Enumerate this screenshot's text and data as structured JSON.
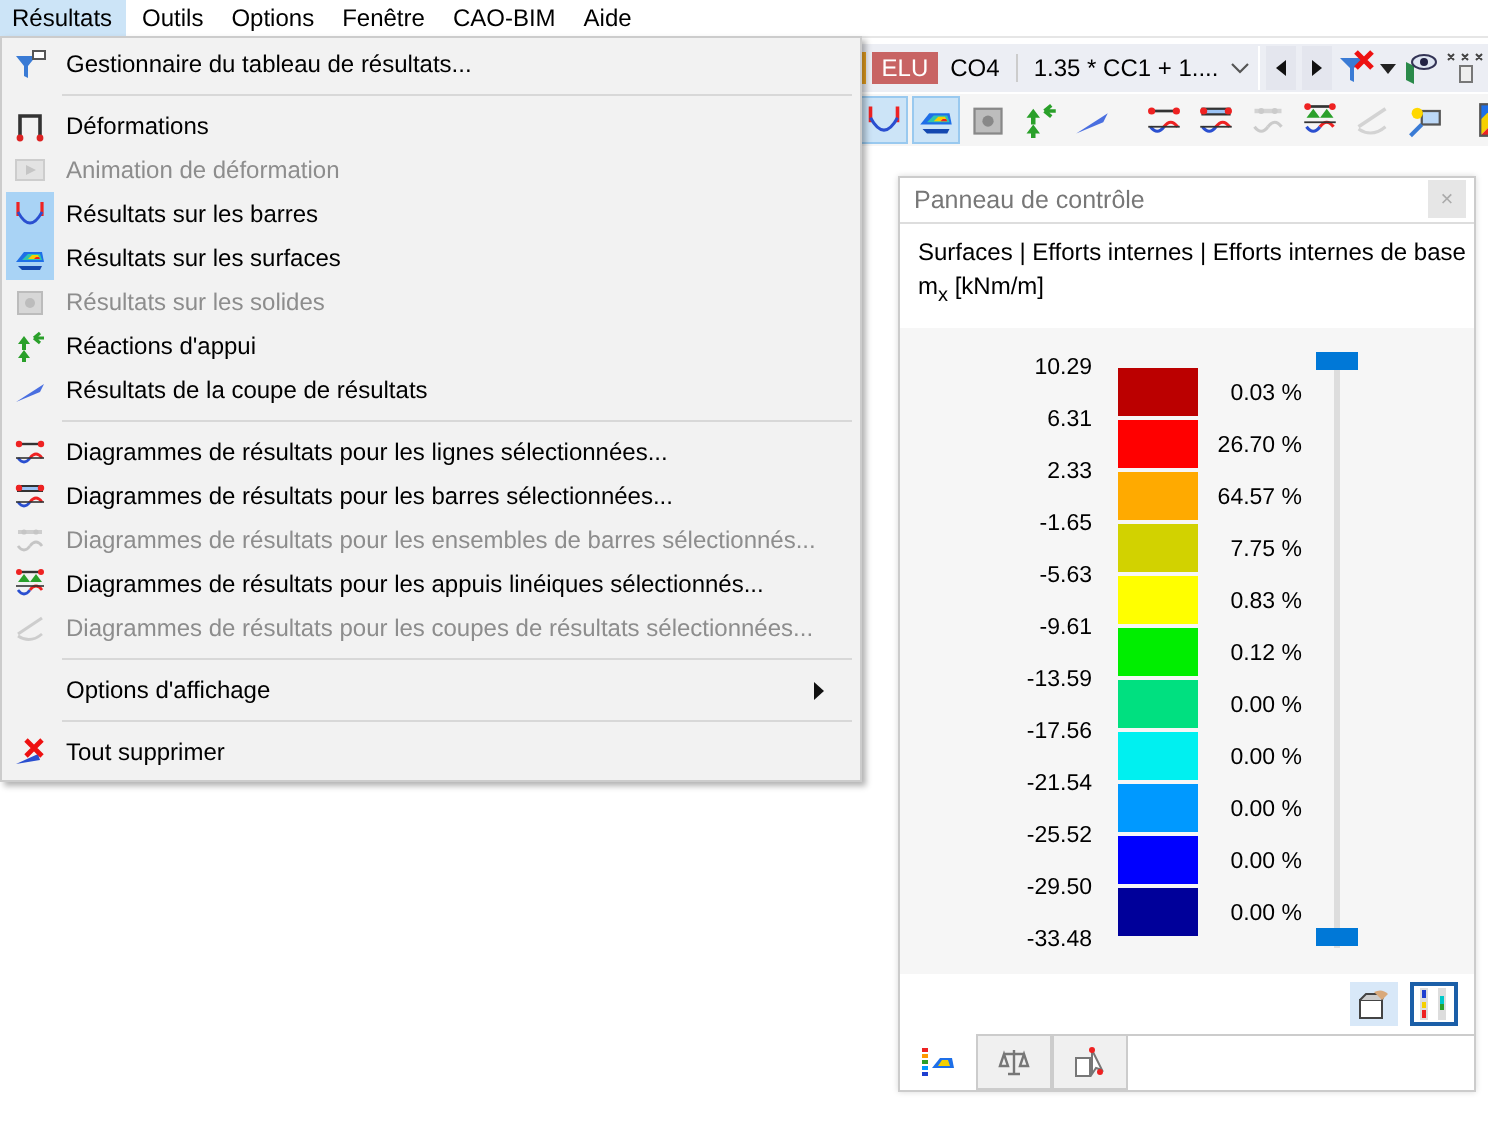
{
  "menubar": [
    {
      "label": "Résultats",
      "selected": true
    },
    {
      "label": "Outils",
      "selected": false
    },
    {
      "label": "Options",
      "selected": false
    },
    {
      "label": "Fenêtre",
      "selected": false
    },
    {
      "label": "CAO-BIM",
      "selected": false
    },
    {
      "label": "Aide",
      "selected": false
    }
  ],
  "menu": {
    "sections": [
      [
        {
          "label": "Gestionnaire du tableau de résultats...",
          "disabled": false,
          "checked": false,
          "submenu": false
        }
      ],
      [
        {
          "label": "Déformations",
          "disabled": false,
          "checked": false,
          "submenu": false
        },
        {
          "label": "Animation de déformation",
          "disabled": true,
          "checked": false,
          "submenu": false
        },
        {
          "label": "Résultats sur les barres",
          "disabled": false,
          "checked": true,
          "submenu": false
        },
        {
          "label": "Résultats sur les surfaces",
          "disabled": false,
          "checked": true,
          "submenu": false
        },
        {
          "label": "Résultats sur les solides",
          "disabled": true,
          "checked": false,
          "submenu": false
        },
        {
          "label": "Réactions d'appui",
          "disabled": false,
          "checked": false,
          "submenu": false
        },
        {
          "label": "Résultats de la coupe de résultats",
          "disabled": false,
          "checked": false,
          "submenu": false
        }
      ],
      [
        {
          "label": "Diagrammes de résultats pour les lignes sélectionnées...",
          "disabled": false,
          "checked": false,
          "submenu": false
        },
        {
          "label": "Diagrammes de résultats pour les barres sélectionnées...",
          "disabled": false,
          "checked": false,
          "submenu": false
        },
        {
          "label": "Diagrammes de résultats pour les ensembles de barres sélectionnés...",
          "disabled": true,
          "checked": false,
          "submenu": false
        },
        {
          "label": "Diagrammes de résultats pour les appuis linéiques sélectionnés...",
          "disabled": false,
          "checked": false,
          "submenu": false
        },
        {
          "label": "Diagrammes de résultats pour les coupes de résultats sélectionnées...",
          "disabled": true,
          "checked": false,
          "submenu": false
        }
      ],
      [
        {
          "label": "Options d'affichage",
          "disabled": false,
          "checked": false,
          "submenu": true
        }
      ],
      [
        {
          "label": "Tout supprimer",
          "disabled": false,
          "checked": false,
          "submenu": false
        }
      ]
    ]
  },
  "toolbar": {
    "result_type": "ELU",
    "combination": "CO4",
    "combination_formula": "1.35 * CC1 + 1....",
    "groups": [
      [
        {
          "checked": true,
          "disabled": false
        },
        {
          "checked": true,
          "disabled": false
        },
        {
          "checked": false,
          "disabled": false
        },
        {
          "checked": false,
          "disabled": false
        },
        {
          "checked": false,
          "disabled": false
        }
      ],
      [
        {
          "checked": false,
          "disabled": false
        },
        {
          "checked": false,
          "disabled": false
        },
        {
          "checked": false,
          "disabled": true
        },
        {
          "checked": false,
          "disabled": false
        },
        {
          "checked": false,
          "disabled": true
        },
        {
          "checked": false,
          "disabled": false
        }
      ],
      [
        {
          "checked": false,
          "disabled": false
        }
      ]
    ]
  },
  "panel": {
    "title": "Panneau de contrôle",
    "close": "×",
    "header": [
      "Surfaces | Efforts internes | Efforts internes de base",
      "m$_{x}$ [kNm/m]"
    ],
    "legend": {
      "values": [
        "10.29",
        "6.31",
        "2.33",
        "-1.65",
        "-5.63",
        "-9.61",
        "-13.59",
        "-17.56",
        "-21.54",
        "-25.52",
        "-29.50",
        "-33.48"
      ],
      "bands": [
        {
          "color": "#bb0000",
          "percent": "0.03 %"
        },
        {
          "color": "#ff0000",
          "percent": "26.70 %"
        },
        {
          "color": "#ffaa00",
          "percent": "64.57 %"
        },
        {
          "color": "#d2d200",
          "percent": "7.75 %"
        },
        {
          "color": "#ffff00",
          "percent": "0.83 %"
        },
        {
          "color": "#00ee00",
          "percent": "0.12 %"
        },
        {
          "color": "#00e080",
          "percent": "0.00 %"
        },
        {
          "color": "#00f0f0",
          "percent": "0.00 %"
        },
        {
          "color": "#0099ff",
          "percent": "0.00 %"
        },
        {
          "color": "#0000ff",
          "percent": "0.00 %"
        },
        {
          "color": "#00009a",
          "percent": "0.00 %"
        }
      ]
    },
    "buttons": [
      {
        "selected": false
      },
      {
        "selected": true
      }
    ],
    "tabs": [
      {
        "selected": true
      },
      {
        "selected": false
      },
      {
        "selected": false
      }
    ]
  }
}
